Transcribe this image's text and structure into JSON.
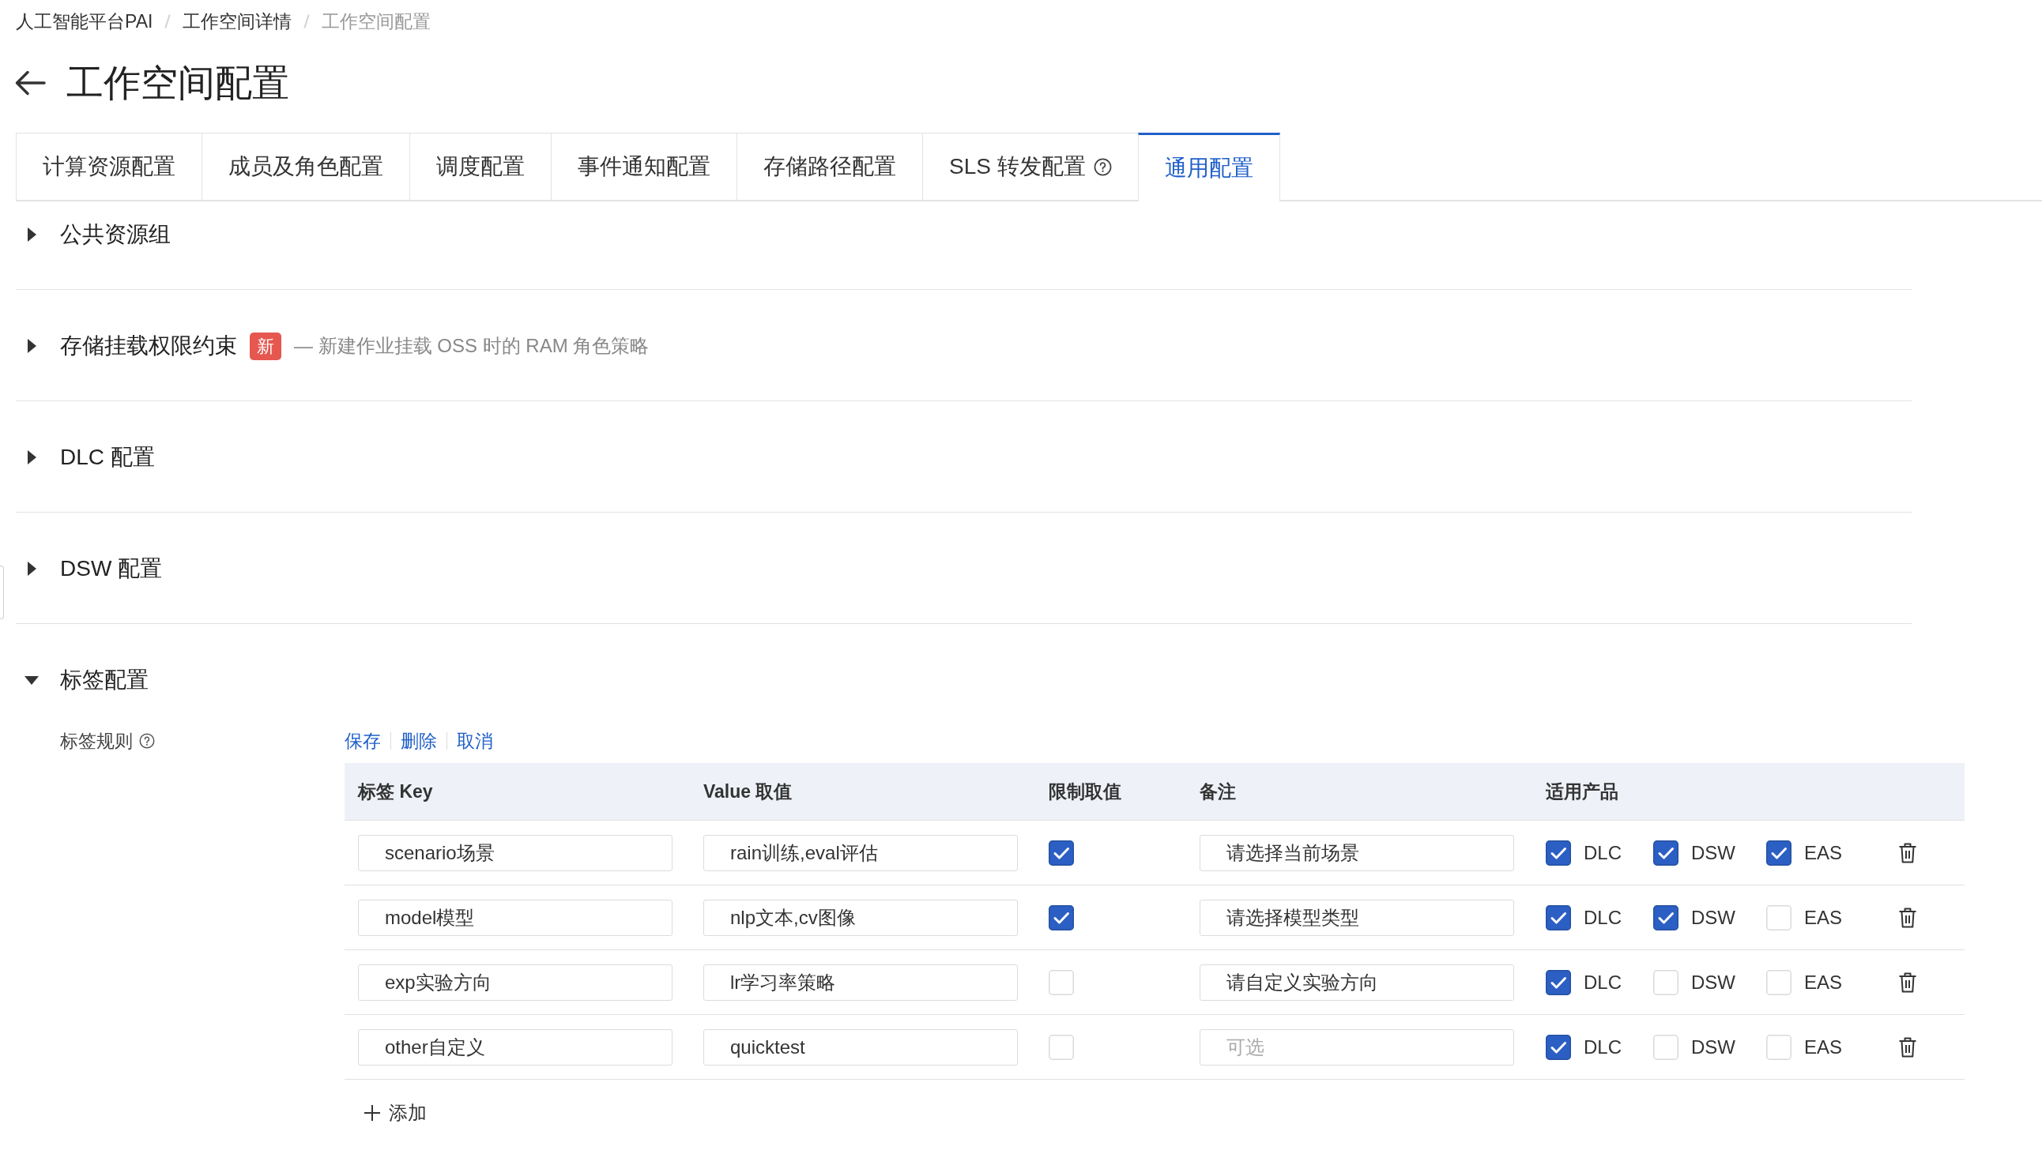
{
  "breadcrumb": [
    {
      "label": "人工智能平台PAI",
      "current": false
    },
    {
      "label": "工作空间详情",
      "current": false
    },
    {
      "label": "工作空间配置",
      "current": true
    }
  ],
  "page": {
    "title": "工作空间配置"
  },
  "tabs": [
    {
      "label": "计算资源配置",
      "selected": false
    },
    {
      "label": "成员及角色配置",
      "selected": false
    },
    {
      "label": "调度配置",
      "selected": false
    },
    {
      "label": "事件通知配置",
      "selected": false
    },
    {
      "label": "存储路径配置",
      "selected": false
    },
    {
      "label": "SLS 转发配置",
      "selected": false,
      "help": true
    },
    {
      "label": "通用配置",
      "selected": true
    }
  ],
  "sections": [
    {
      "title": "公共资源组",
      "expanded": false
    },
    {
      "title": "存储挂载权限约束",
      "expanded": false,
      "badge": "新",
      "description": "— 新建作业挂载 OSS 时的 RAM 角色策略"
    },
    {
      "title": "DLC 配置",
      "expanded": false
    },
    {
      "title": "DSW 配置",
      "expanded": false
    },
    {
      "title": "标签配置",
      "expanded": true,
      "tag_rules": {
        "label": "标签规则",
        "help": true,
        "actions": [
          "保存",
          "删除",
          "取消"
        ],
        "columns": [
          "标签 Key",
          "Value 取值",
          "限制取值",
          "备注",
          "适用产品"
        ],
        "rows": [
          {
            "key": "scenario场景",
            "value": "rain训练,eval评估",
            "restricted": true,
            "note": {
              "value": "请选择当前场景"
            },
            "products": [
              {
                "label": "DLC",
                "checked": true
              },
              {
                "label": "DSW",
                "checked": true
              },
              {
                "label": "EAS",
                "checked": true
              }
            ]
          },
          {
            "key": "model模型",
            "value": "nlp文本,cv图像",
            "restricted": true,
            "note": {
              "value": "请选择模型类型"
            },
            "products": [
              {
                "label": "DLC",
                "checked": true
              },
              {
                "label": "DSW",
                "checked": true
              },
              {
                "label": "EAS",
                "checked": false
              }
            ]
          },
          {
            "key": "exp实验方向",
            "value": "lr学习率策略",
            "restricted": false,
            "note": {
              "value": "请自定义实验方向"
            },
            "products": [
              {
                "label": "DLC",
                "checked": true
              },
              {
                "label": "DSW",
                "checked": false
              },
              {
                "label": "EAS",
                "checked": false
              }
            ]
          },
          {
            "key": "other自定义",
            "value": "quicktest",
            "restricted": false,
            "note": {
              "placeholder": "可选"
            },
            "products": [
              {
                "label": "DLC",
                "checked": true
              },
              {
                "label": "DSW",
                "checked": false
              },
              {
                "label": "EAS",
                "checked": false
              }
            ]
          }
        ],
        "add_label": "添加"
      }
    }
  ]
}
